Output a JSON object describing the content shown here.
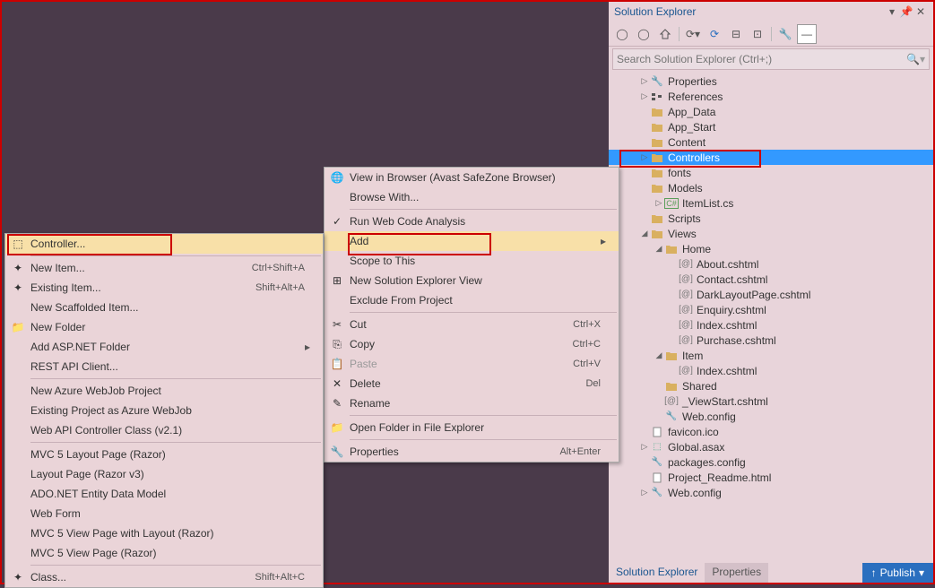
{
  "solution_explorer": {
    "title": "Solution Explorer",
    "search_placeholder": "Search Solution Explorer (Ctrl+;)",
    "tree": [
      {
        "depth": 1,
        "arrow": "▷",
        "icon": "wrench",
        "label": "Properties"
      },
      {
        "depth": 1,
        "arrow": "▷",
        "icon": "refs",
        "label": "References"
      },
      {
        "depth": 1,
        "arrow": "",
        "icon": "folder",
        "label": "App_Data"
      },
      {
        "depth": 1,
        "arrow": "",
        "icon": "folder",
        "label": "App_Start"
      },
      {
        "depth": 1,
        "arrow": "",
        "icon": "folder",
        "label": "Content"
      },
      {
        "depth": 1,
        "arrow": "▷",
        "icon": "folder",
        "label": "Controllers",
        "selected": true
      },
      {
        "depth": 1,
        "arrow": "",
        "icon": "folder",
        "label": "fonts"
      },
      {
        "depth": 1,
        "arrow": "",
        "icon": "folder",
        "label": "Models"
      },
      {
        "depth": 2,
        "arrow": "▷",
        "icon": "cs",
        "label": "ItemList.cs"
      },
      {
        "depth": 1,
        "arrow": "",
        "icon": "folder",
        "label": "Scripts"
      },
      {
        "depth": 1,
        "arrow": "◢",
        "icon": "folder",
        "label": "Views"
      },
      {
        "depth": 2,
        "arrow": "◢",
        "icon": "folder",
        "label": "Home"
      },
      {
        "depth": 3,
        "arrow": "",
        "icon": "cshtml",
        "label": "About.cshtml"
      },
      {
        "depth": 3,
        "arrow": "",
        "icon": "cshtml",
        "label": "Contact.cshtml"
      },
      {
        "depth": 3,
        "arrow": "",
        "icon": "cshtml",
        "label": "DarkLayoutPage.cshtml"
      },
      {
        "depth": 3,
        "arrow": "",
        "icon": "cshtml",
        "label": "Enquiry.cshtml"
      },
      {
        "depth": 3,
        "arrow": "",
        "icon": "cshtml",
        "label": "Index.cshtml"
      },
      {
        "depth": 3,
        "arrow": "",
        "icon": "cshtml",
        "label": "Purchase.cshtml"
      },
      {
        "depth": 2,
        "arrow": "◢",
        "icon": "folder",
        "label": "Item"
      },
      {
        "depth": 3,
        "arrow": "",
        "icon": "cshtml",
        "label": "Index.cshtml"
      },
      {
        "depth": 2,
        "arrow": "",
        "icon": "folder",
        "label": "Shared"
      },
      {
        "depth": 2,
        "arrow": "",
        "icon": "cshtml",
        "label": "_ViewStart.cshtml"
      },
      {
        "depth": 2,
        "arrow": "",
        "icon": "config",
        "label": "Web.config"
      },
      {
        "depth": 1,
        "arrow": "",
        "icon": "file",
        "label": "favicon.ico"
      },
      {
        "depth": 1,
        "arrow": "▷",
        "icon": "asax",
        "label": "Global.asax"
      },
      {
        "depth": 1,
        "arrow": "",
        "icon": "config",
        "label": "packages.config"
      },
      {
        "depth": 1,
        "arrow": "",
        "icon": "html",
        "label": "Project_Readme.html"
      },
      {
        "depth": 1,
        "arrow": "▷",
        "icon": "config",
        "label": "Web.config"
      }
    ],
    "tabs": {
      "active": "Solution Explorer",
      "other": "Properties"
    }
  },
  "context_main": [
    {
      "icon": "browser",
      "label": "View in Browser (Avast SafeZone Browser)"
    },
    {
      "label": "Browse With..."
    },
    {
      "sep": true
    },
    {
      "icon": "analysis",
      "label": "Run Web Code Analysis"
    },
    {
      "label": "Add",
      "highlighted": true,
      "sub": true
    },
    {
      "label": "Scope to This"
    },
    {
      "icon": "newview",
      "label": "New Solution Explorer View"
    },
    {
      "label": "Exclude From Project"
    },
    {
      "sep": true
    },
    {
      "icon": "cut",
      "label": "Cut",
      "shortcut": "Ctrl+X"
    },
    {
      "icon": "copy",
      "label": "Copy",
      "shortcut": "Ctrl+C"
    },
    {
      "icon": "paste",
      "label": "Paste",
      "shortcut": "Ctrl+V",
      "disabled": true
    },
    {
      "icon": "delete",
      "label": "Delete",
      "shortcut": "Del"
    },
    {
      "icon": "rename",
      "label": "Rename"
    },
    {
      "sep": true
    },
    {
      "icon": "openfolder",
      "label": "Open Folder in File Explorer"
    },
    {
      "sep": true
    },
    {
      "icon": "props",
      "label": "Properties",
      "shortcut": "Alt+Enter"
    }
  ],
  "context_sub": [
    {
      "icon": "controller",
      "label": "Controller...",
      "highlighted": true
    },
    {
      "sep": true
    },
    {
      "icon": "newitem",
      "label": "New Item...",
      "shortcut": "Ctrl+Shift+A"
    },
    {
      "icon": "existitem",
      "label": "Existing Item...",
      "shortcut": "Shift+Alt+A"
    },
    {
      "label": "New Scaffolded Item..."
    },
    {
      "icon": "newfolder",
      "label": "New Folder"
    },
    {
      "label": "Add ASP.NET Folder",
      "sub": true
    },
    {
      "label": "REST API Client..."
    },
    {
      "sep": true
    },
    {
      "label": "New Azure WebJob Project"
    },
    {
      "label": "Existing Project as Azure WebJob"
    },
    {
      "label": "Web API Controller Class (v2.1)"
    },
    {
      "sep": true
    },
    {
      "label": "MVC 5 Layout Page (Razor)"
    },
    {
      "label": "Layout Page (Razor v3)"
    },
    {
      "label": "ADO.NET Entity Data Model"
    },
    {
      "label": "Web Form"
    },
    {
      "label": "MVC 5 View Page with Layout (Razor)"
    },
    {
      "label": "MVC 5 View Page (Razor)"
    },
    {
      "sep": true
    },
    {
      "icon": "class",
      "label": "Class...",
      "shortcut": "Shift+Alt+C"
    }
  ],
  "publish": "Publish"
}
